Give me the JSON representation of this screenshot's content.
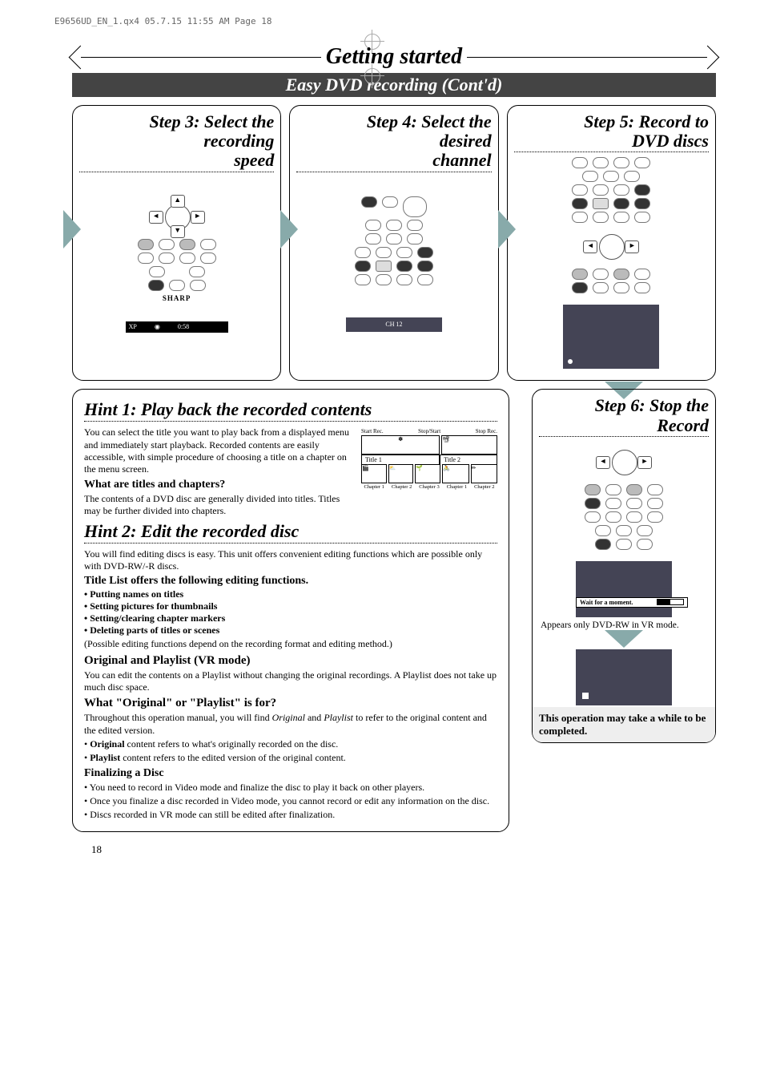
{
  "page_info": "E9656UD_EN_1.qx4  05.7.15  11:55 AM  Page 18",
  "title": "Getting started",
  "subtitle": "Easy DVD recording (Cont'd)",
  "step3": {
    "title_l1": "Step 3: Select the",
    "title_l2": "recording",
    "title_l3": "speed",
    "screen_mode": "XP",
    "screen_time": "0:58"
  },
  "step4": {
    "title_l1": "Step 4: Select the",
    "title_l2": "desired",
    "title_l3": "channel",
    "screen": "CH  12"
  },
  "step5": {
    "title_l1": "Step 5: Record to",
    "title_l2": "DVD discs"
  },
  "hint1": {
    "title": "Hint 1: Play back the recorded contents",
    "body": "You can select the title you want to play back from a displayed menu and immediately start playback. Recorded contents are easily accessible, with simple procedure of choosing a title on a chapter on the menu screen.",
    "sub_q": "What are titles and chapters?",
    "sub_a": "The contents of a DVD disc are generally divided into titles. Titles may be further divided into chapters.",
    "dg": {
      "start": "Start Rec.",
      "ss": "Stop/Start",
      "stop": "Stop Rec.",
      "t1": "Title 1",
      "t2": "Title 2",
      "ch": [
        "Chapter 1",
        "Chapter 2",
        "Chapter 3",
        "Chapter 1",
        "Chapter 2"
      ]
    }
  },
  "hint2": {
    "title": "Hint 2: Edit the recorded disc",
    "body": "You will find editing discs is easy. This unit offers convenient editing functions which are possible only with DVD-RW/-R discs.",
    "tl_h": "Title List offers the following editing functions.",
    "items": [
      "Putting names on titles",
      "Setting pictures for thumbnails",
      "Setting/clearing chapter markers",
      "Deleting parts of titles or scenes"
    ],
    "items_note": "(Possible editing functions depend on the recording format and editing method.)",
    "op_h": "Original and Playlist (VR mode)",
    "op_body": "You can edit the contents on a Playlist without changing the original recordings.  A Playlist does not take up much disc space.",
    "wp_h": "What \"Original\" or \"Playlist\" is for?",
    "wp_body1": "Throughout this operation manual, you will find ",
    "wp_body2": " and ",
    "wp_body3": " to refer to the original content and the edited version.",
    "wp_i1": "Original",
    "wp_i2": "Playlist",
    "or_li": " content refers to what's originally recorded on the disc.",
    "pl_li": " content refers to the edited version of the original content.",
    "fin_h": "Finalizing a Disc",
    "fin1": "You need to record in Video mode and finalize the disc to play it back on other players.",
    "fin2": "Once you finalize a disc recorded in Video mode, you cannot record or edit any information on the disc.",
    "fin3": "Discs recorded in VR mode can still be edited after finalization."
  },
  "step6": {
    "title_l1": "Step 6: Stop the",
    "title_l2": "Record",
    "wait": "Wait for a moment.",
    "appears": "Appears only DVD-RW in VR mode.",
    "note": "This operation may take a while to be completed."
  },
  "page_num": "18"
}
